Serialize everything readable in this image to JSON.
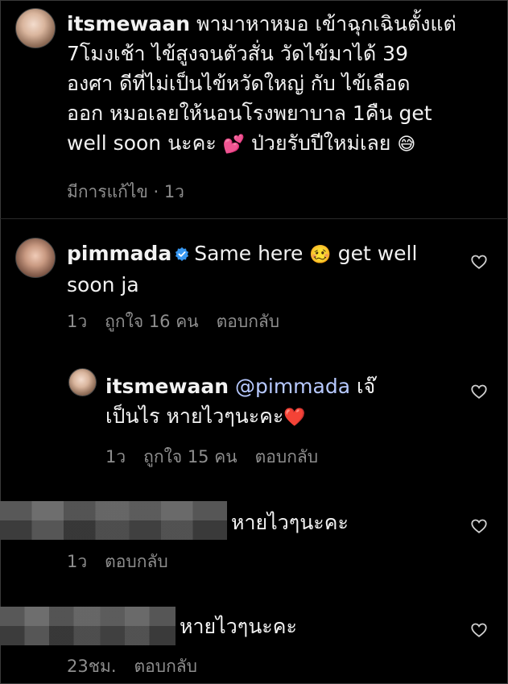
{
  "post": {
    "username": "itsmewaan",
    "text_line1": " พามาหาหมอ เข้าฉุกเฉินตั้งแต่",
    "text_line2": "7โมงเช้า ไข้สูงจนตัวสั่น วัดไข้มาได้ 39",
    "text_line3": "องศา ดีที่ไม่เป็นไข้หวัดใหญ่ กับ ไข้เลือด",
    "text_line4": "ออก หมอเลยให้นอนโรงพยาบาล 1คืน get",
    "text_line5a": "well soon นะคะ ",
    "emoji1": "💕",
    "text_line5b": " ป่วยรับปีใหม่เลย ",
    "emoji2": "😅",
    "meta": "มีการแก้ไข · 1ว"
  },
  "comments": [
    {
      "username": "pimmada",
      "text_a": "Same here ",
      "emoji": "🥴",
      "text_b": " get well",
      "text_line2": "soon ja",
      "time": "1ว",
      "likes": "ถูกใจ 16 คน",
      "reply": "ตอบกลับ"
    },
    {
      "username": "itsmewaan",
      "mention": "@pimmada",
      "text_a": " เจ๊",
      "text_line2": "เป็นไร หายไวๆนะคะ",
      "emoji": "❤️",
      "time": "1ว",
      "likes": "ถูกใจ 15 คน",
      "reply": "ตอบกลับ"
    },
    {
      "text": "หายไวๆนะคะ",
      "time": "1ว",
      "reply": "ตอบกลับ"
    },
    {
      "text": "หายไวๆนะคะ",
      "time": "23ชม.",
      "reply": "ตอบกลับ"
    }
  ],
  "icons": {
    "heart": "heart-outline-icon",
    "verified": "verified-badge-icon"
  },
  "colors": {
    "background": "#000000",
    "text": "#f2f2f2",
    "meta": "#8e8e8e",
    "verified": "#3897f0"
  }
}
